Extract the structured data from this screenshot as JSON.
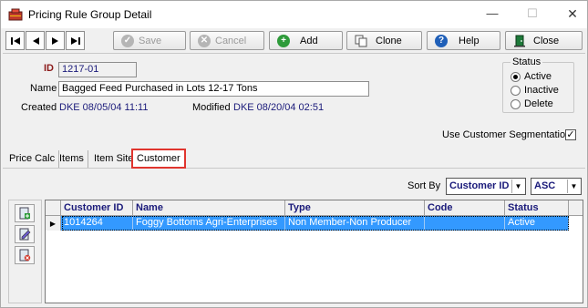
{
  "window": {
    "title": "Pricing Rule Group Detail",
    "minimize_glyph": "—",
    "maximize_glyph": "☐",
    "close_glyph": "✕"
  },
  "toolbar": {
    "save_label": "Save",
    "cancel_label": "Cancel",
    "add_label": "Add",
    "clone_label": "Clone",
    "help_label": "Help",
    "close_label": "Close"
  },
  "form": {
    "id_label": "ID",
    "id_value": "1217-01",
    "name_label": "Name",
    "name_value": "Bagged Feed Purchased in Lots 12-17 Tons",
    "created_label": "Created",
    "created_value": "DKE 08/05/04 11:11",
    "modified_label": "Modified",
    "modified_value": "DKE 08/20/04 02:51",
    "use_segmentation_label": "Use Customer Segmentation",
    "use_segmentation_checked": true
  },
  "status": {
    "legend": "Status",
    "options": [
      "Active",
      "Inactive",
      "Delete"
    ],
    "selected": "Active"
  },
  "tabs": [
    {
      "label": "Price Calc"
    },
    {
      "label": "Items"
    },
    {
      "label": "Item Site"
    },
    {
      "label": "Customer",
      "active": true
    }
  ],
  "sort": {
    "label": "Sort By",
    "field": "Customer ID",
    "direction": "ASC"
  },
  "grid": {
    "columns": [
      "Customer ID",
      "Name",
      "Type",
      "Code",
      "Status"
    ],
    "rows": [
      {
        "customer_id": "1014264",
        "name": "Foggy Bottoms Agri-Enterprises",
        "type": "Non Member-Non Producer",
        "code": "",
        "status": "Active"
      }
    ]
  },
  "colors": {
    "selection": "#3399ff",
    "label_blue": "#1a1a7a",
    "id_label": "#8b1a1a",
    "active_tab_border": "#e0352e"
  }
}
